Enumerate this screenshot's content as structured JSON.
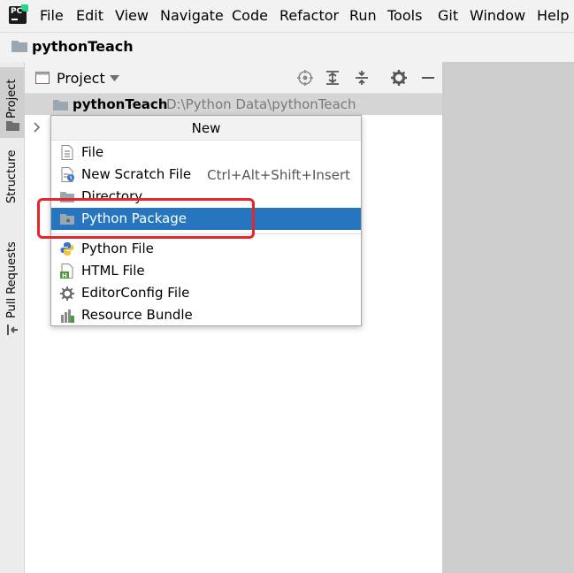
{
  "menubar": {
    "items": [
      "File",
      "Edit",
      "View",
      "Navigate",
      "Code",
      "Refactor",
      "Run",
      "Tools",
      "Git",
      "Window",
      "Help"
    ]
  },
  "navbar": {
    "project_name": "pythonTeach"
  },
  "side_tabs": [
    "Project",
    "Structure",
    "Pull Requests"
  ],
  "panel": {
    "title": "Project",
    "root_name": "pythonTeach",
    "root_path": "D:\\Python Data\\pythonTeach"
  },
  "popup": {
    "title": "New",
    "items": [
      {
        "label": "File",
        "shortcut": "",
        "icon": "file-icon"
      },
      {
        "label": "New Scratch File",
        "shortcut": "Ctrl+Alt+Shift+Insert",
        "icon": "scratch-file-icon"
      },
      {
        "label": "Directory",
        "shortcut": "",
        "icon": "folder-icon"
      },
      {
        "label": "Python Package",
        "shortcut": "",
        "icon": "package-icon"
      },
      {
        "label": "Python File",
        "shortcut": "",
        "icon": "python-icon"
      },
      {
        "label": "HTML File",
        "shortcut": "",
        "icon": "html-icon"
      },
      {
        "label": "EditorConfig File",
        "shortcut": "",
        "icon": "gear-icon"
      },
      {
        "label": "Resource Bundle",
        "shortcut": "",
        "icon": "resource-bundle-icon"
      }
    ],
    "selected_index": 3
  },
  "colors": {
    "selection": "#2675bf",
    "highlight_box": "#e6262c",
    "folder": "#9aa7b0",
    "python_blue": "#3b78c2",
    "python_yellow": "#f2c53d",
    "html_green": "#4e9a3a"
  }
}
